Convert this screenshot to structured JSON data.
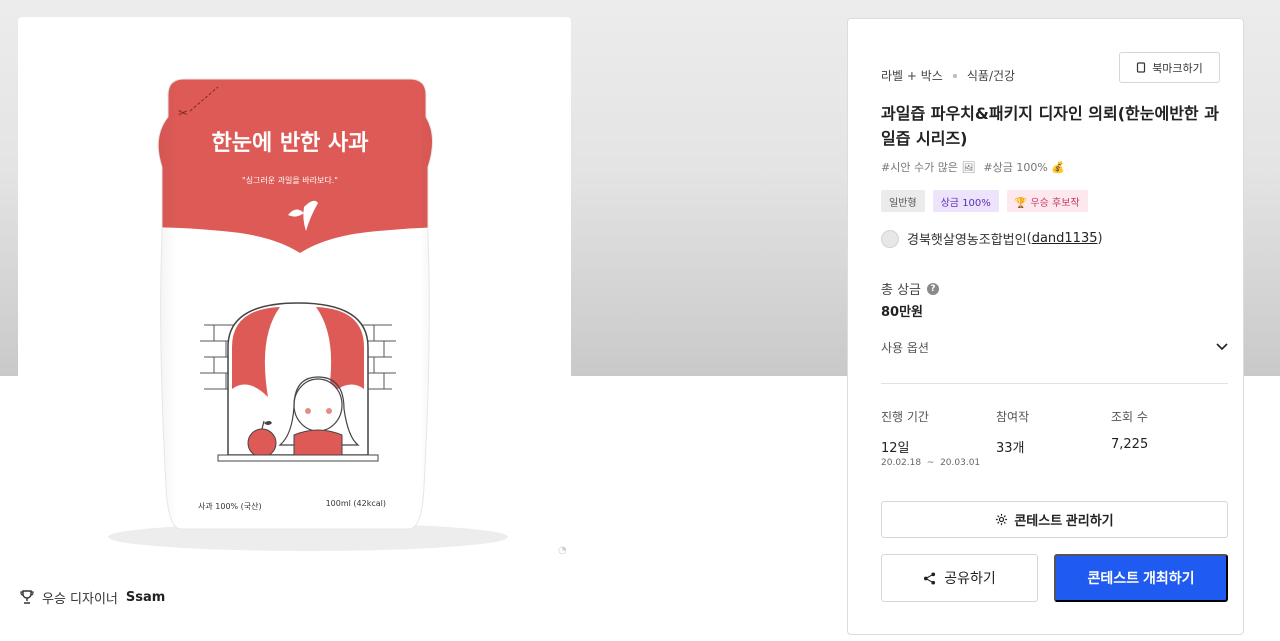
{
  "product_image": {
    "headline": "한눈에 반한 사과",
    "tagline": "\"싱그러운 과일을 바라보다.\"",
    "left_label": "사과 100% (국산)",
    "right_label": "100ml (42kcal)"
  },
  "winner": {
    "label": "우승 디자이너",
    "name": "Ssam"
  },
  "panel": {
    "breadcrumb": [
      "라벨 + 박스",
      "식품/건강"
    ],
    "bookmark_label": "북마크하기",
    "title": "과일즙 파우치&패키지 디자인 의뢰(한눈에반한 과일즙 시리즈)",
    "hashtags": [
      "#시안 수가 많은 🖼",
      "#상금 100% 💰"
    ],
    "badges": [
      {
        "label": "일반형",
        "style": "gray"
      },
      {
        "label": "상금 100%",
        "style": "purple"
      },
      {
        "label": "🏆 우승 후보작",
        "style": "pink"
      }
    ],
    "host_name": "경북햇살영농조합법인",
    "host_handle": "dand1135",
    "prize_label": "총 상금",
    "prize_value": "80만원",
    "usage_label": "사용 옵션",
    "stats": {
      "period_label": "진행 기간",
      "period_value": "12일",
      "period_range": "20.02.18  ~  20.03.01",
      "entries_label": "참여작",
      "entries_value": "33개",
      "views_label": "조회 수",
      "views_value": "7,225"
    },
    "manage_label": "콘테스트 관리하기",
    "share_label": "공유하기",
    "host_contest_label": "콘테스트 개최하기"
  },
  "colors": {
    "accent_blue": "#1f5bf0",
    "pouch_red": "#dd5a56",
    "purple_badge": "#ede3fb",
    "pink_badge": "#fde8ee"
  }
}
